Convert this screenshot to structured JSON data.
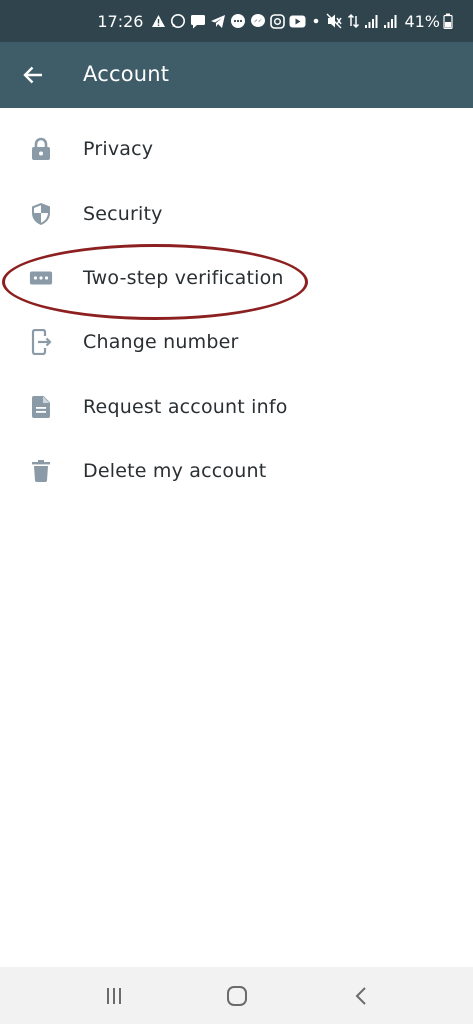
{
  "status_bar": {
    "time": "17:26",
    "battery": "41%",
    "icons": [
      "warning-icon",
      "whatsapp-icon",
      "message-icon",
      "telegram-icon",
      "chat-icon",
      "messenger-icon",
      "instagram-icon",
      "youtube-icon",
      "dot-icon",
      "mute-icon",
      "data-arrows-icon",
      "signal-icon",
      "signal-icon",
      "battery-icon"
    ]
  },
  "app_bar": {
    "title": "Account",
    "background": "#3f5c69"
  },
  "items": [
    {
      "label": "Privacy",
      "icon": "lock-icon"
    },
    {
      "label": "Security",
      "icon": "shield-icon"
    },
    {
      "label": "Two-step verification",
      "icon": "dots-icon"
    },
    {
      "label": "Change number",
      "icon": "change-number-icon"
    },
    {
      "label": "Request account info",
      "icon": "document-icon"
    },
    {
      "label": "Delete my account",
      "icon": "trash-icon"
    }
  ],
  "colors": {
    "icon": "#8a9ba7",
    "annotation": "#8c1f1f"
  }
}
